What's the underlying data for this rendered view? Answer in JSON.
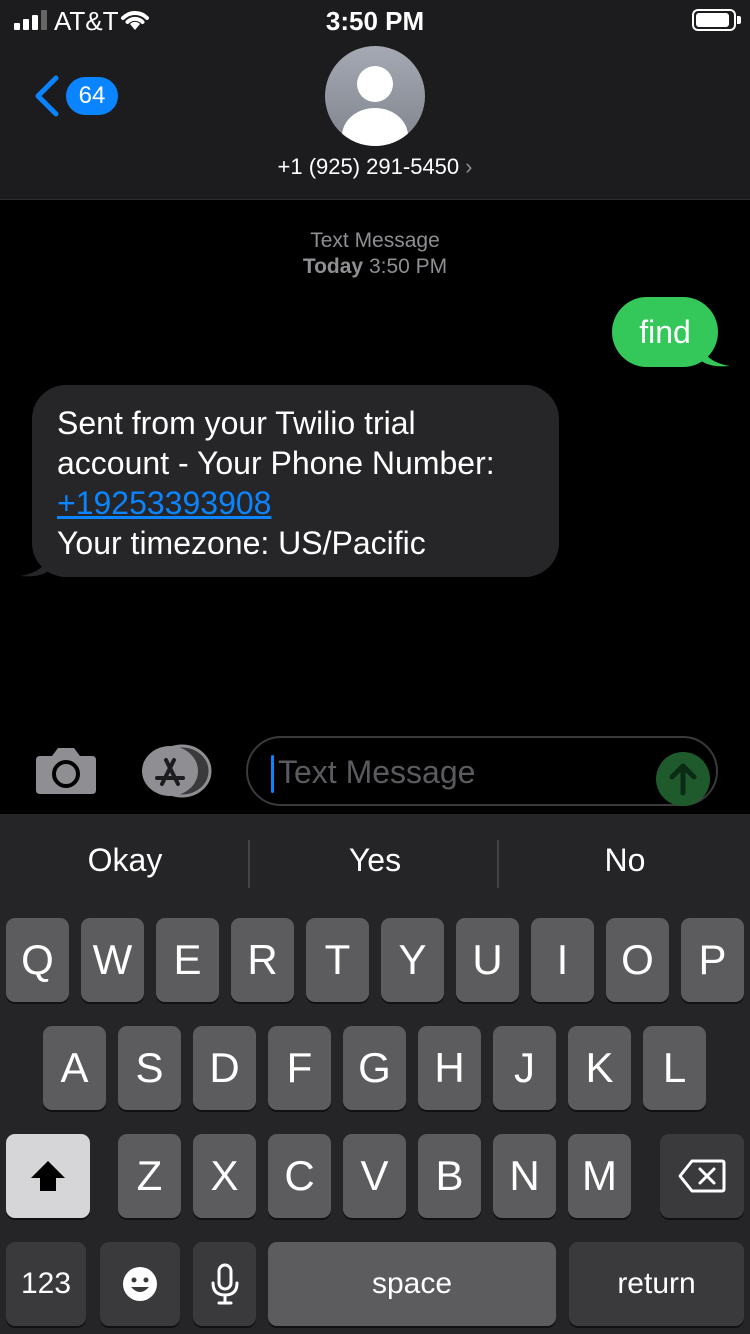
{
  "status_bar": {
    "carrier": "AT&T",
    "time": "3:50 PM"
  },
  "header": {
    "back_count": "64",
    "contact": "+1 (925) 291-5450",
    "contact_arrow": "›"
  },
  "messages": {
    "timestamp_type": "Text Message",
    "timestamp_day": "Today",
    "timestamp_time": "3:50 PM",
    "outgoing": "find",
    "incoming_line1": "Sent from your Twilio trial",
    "incoming_line2": "account - Your Phone Number:",
    "incoming_link": "+19253393908",
    "incoming_line4": "Your timezone: US/Pacific"
  },
  "composer": {
    "placeholder": "Text Message"
  },
  "keyboard": {
    "suggestions": [
      "Okay",
      "Yes",
      "No"
    ],
    "row1": [
      "Q",
      "W",
      "E",
      "R",
      "T",
      "Y",
      "U",
      "I",
      "O",
      "P"
    ],
    "row2": [
      "A",
      "S",
      "D",
      "F",
      "G",
      "H",
      "J",
      "K",
      "L"
    ],
    "row3": [
      "Z",
      "X",
      "C",
      "V",
      "B",
      "N",
      "M"
    ],
    "numbers_label": "123",
    "space_label": "space",
    "return_label": "return"
  },
  "colors": {
    "accent": "#0a84ff",
    "sent_bubble": "#34c759",
    "received_bubble": "#262628"
  }
}
